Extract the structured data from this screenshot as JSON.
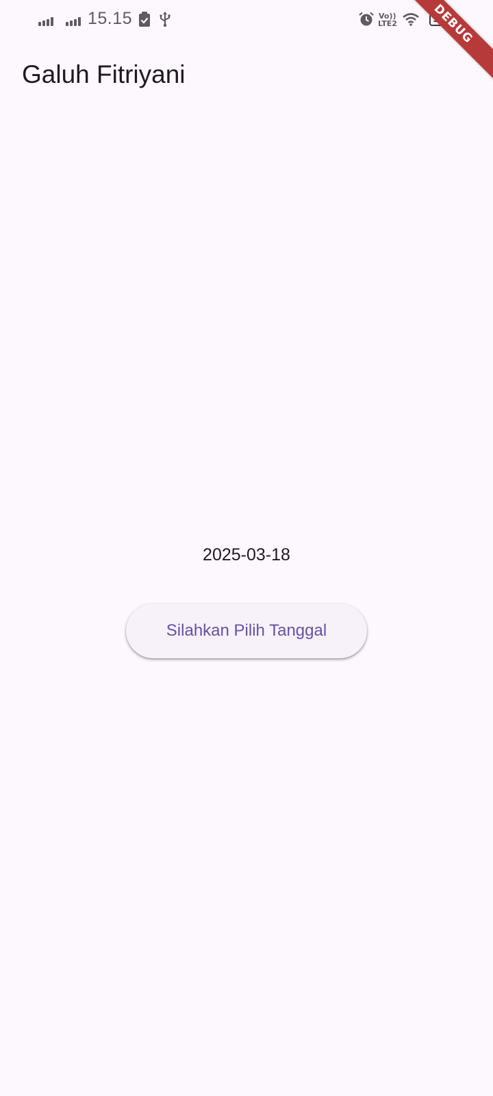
{
  "status_bar": {
    "time": "15.15",
    "volte_label": "Vo))",
    "lte_label": "LTE2",
    "battery_level": "100"
  },
  "debug_banner": {
    "label": "DEBUG",
    "color": "#b73a3a"
  },
  "app_bar": {
    "title": "Galuh Fitriyani"
  },
  "main": {
    "selected_date": "2025-03-18",
    "pick_date_button_label": "Silahkan Pilih Tanggal"
  },
  "colors": {
    "background": "#fdf7fe",
    "button_background": "#f7f2fa",
    "button_text": "#6750a4",
    "text_primary": "#1d1b20",
    "status_icons": "#5f5b62"
  }
}
